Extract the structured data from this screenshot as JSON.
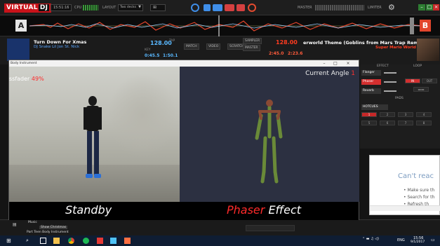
{
  "app": {
    "logo_a": "VIRTUAL",
    "logo_b": "DJ",
    "time": "15:51:16",
    "cpu_label": "CPU",
    "layout_label": "LAYOUT",
    "layout_value": "Two decks",
    "master_label": "MASTER",
    "limiter_label": "LIMITER"
  },
  "deck_a": {
    "letter": "A",
    "title": "Turn Down For Xmas",
    "artist": "DJ Snake Lil Jon  St. Nick",
    "bpm": "128.00",
    "key": "KEY",
    "elapsed": "0:45.5",
    "remain": "1:50.1",
    "tap": "TAP"
  },
  "deck_b": {
    "letter": "B",
    "title": "erworld Theme (Goblins from Mars Trap Remix) (Lo",
    "artist": "Super Mario World",
    "bpm": "128.00",
    "elapsed": "2:45.0",
    "remain": "2:23.6"
  },
  "mixer": {
    "match": "MATCH",
    "video": "VIDEO",
    "scratch": "SCRATCH",
    "sampler": "SAMPLER",
    "master": "MASTER"
  },
  "fx": {
    "effect_header": "EFFECT",
    "loop_header": "LOOP",
    "fx1": "Flanger",
    "fx2": "Phaser",
    "fx3": "Reverb",
    "in_label": "IN",
    "out_label": "OUT",
    "pads": "PADS",
    "hotcues": "HOTCUES",
    "cue_numbers": [
      "1",
      "2",
      "3",
      "4",
      "5",
      "6",
      "7",
      "8"
    ]
  },
  "tracker": {
    "window_title": "Body Instrument",
    "crossfader_label": "ssfader",
    "crossfader_value": "49%",
    "angle_label": "Current Angle",
    "angle_value": "1",
    "caption_left": "Standby",
    "caption_fx": "Phaser",
    "caption_right": " Effect"
  },
  "browser": {
    "headline": "Can't reac",
    "bullet1": "Make sure th",
    "bullet2": "Search for th",
    "bullet3": "Refresh th"
  },
  "library": {
    "folder1": "Music",
    "folder2": "Show Christmas",
    "folder3": "Part Teen Body Instrument"
  },
  "taskbar": {
    "clock_time": "15:56",
    "clock_date": "9/1/2017",
    "lang": "ENG"
  },
  "colors": {
    "brand_red": "#c9131a",
    "deck_a_blue": "#5aa6ff",
    "deck_b_red": "#ff3b1f",
    "caption_red": "#ff2a2a",
    "skeleton_green": "#6a8a38",
    "skeleton_joint": "#8a4a34"
  }
}
